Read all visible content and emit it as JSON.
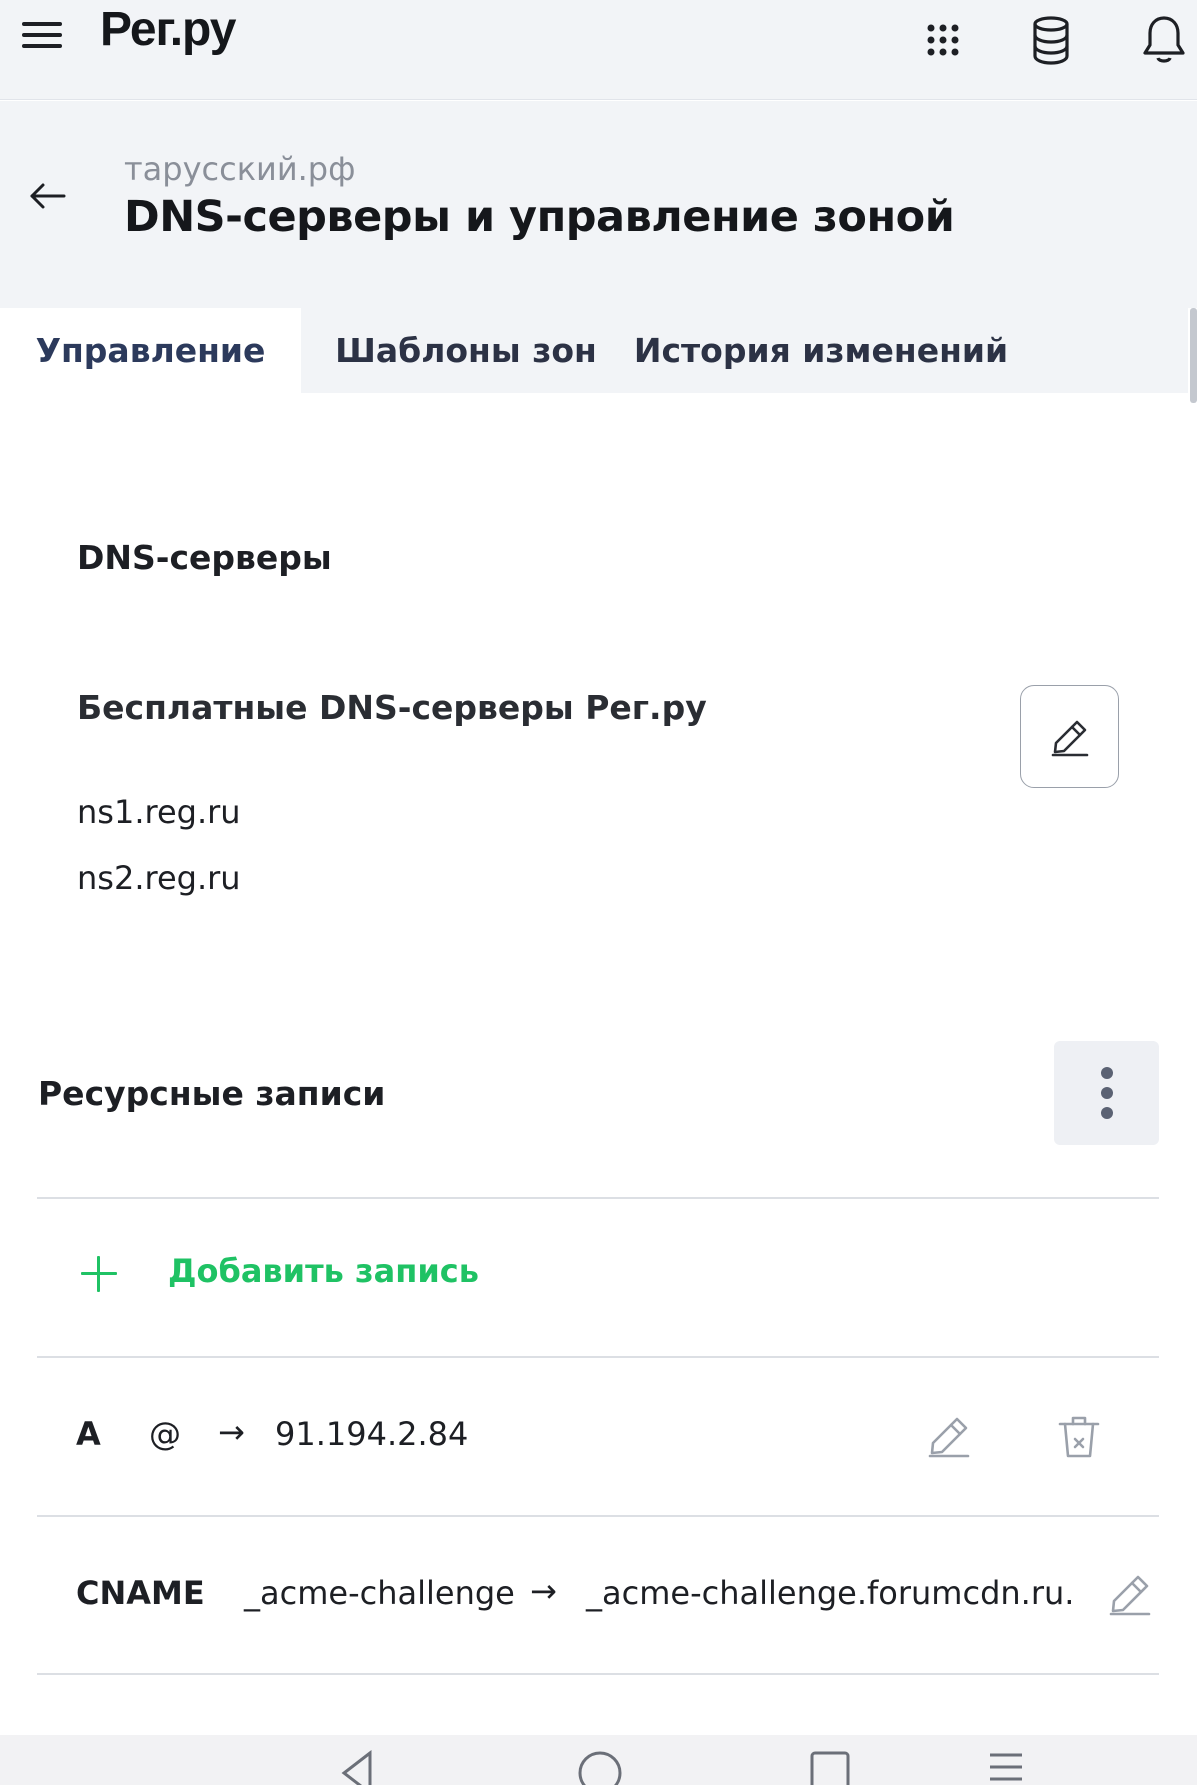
{
  "app": {
    "logo": "Рег.ру"
  },
  "header": {
    "breadcrumb": "тарусский.рф",
    "title": "DNS-серверы и управление зоной"
  },
  "tabs": [
    {
      "label": "Управление",
      "active": true
    },
    {
      "label": "Шаблоны зон",
      "active": false
    },
    {
      "label": "История изменений",
      "active": false
    }
  ],
  "dns_servers": {
    "section_title": "DNS-серверы",
    "subtitle": "Бесплатные DNS-серверы Рег.ру",
    "servers": [
      "ns1.reg.ru",
      "ns2.reg.ru"
    ]
  },
  "resource_records": {
    "section_title": "Ресурсные записи",
    "add_label": "Добавить запись",
    "records": [
      {
        "type": "A",
        "name": "@",
        "arrow": "→",
        "value": "91.194.2.84"
      },
      {
        "type": "CNAME",
        "name": "_acme-challenge",
        "arrow": "→",
        "value": "_acme-challenge.forumcdn.ru."
      }
    ]
  },
  "colors": {
    "accent_green": "#1fc264",
    "header_bg": "#f2f4f7",
    "text_primary": "#1d1f24",
    "text_muted": "#8a8f99"
  },
  "icons": [
    "menu-icon",
    "apps-grid-icon",
    "database-icon",
    "bell-icon",
    "arrow-left-icon",
    "pencil-icon",
    "more-vertical-icon",
    "plus-icon",
    "trash-icon"
  ]
}
